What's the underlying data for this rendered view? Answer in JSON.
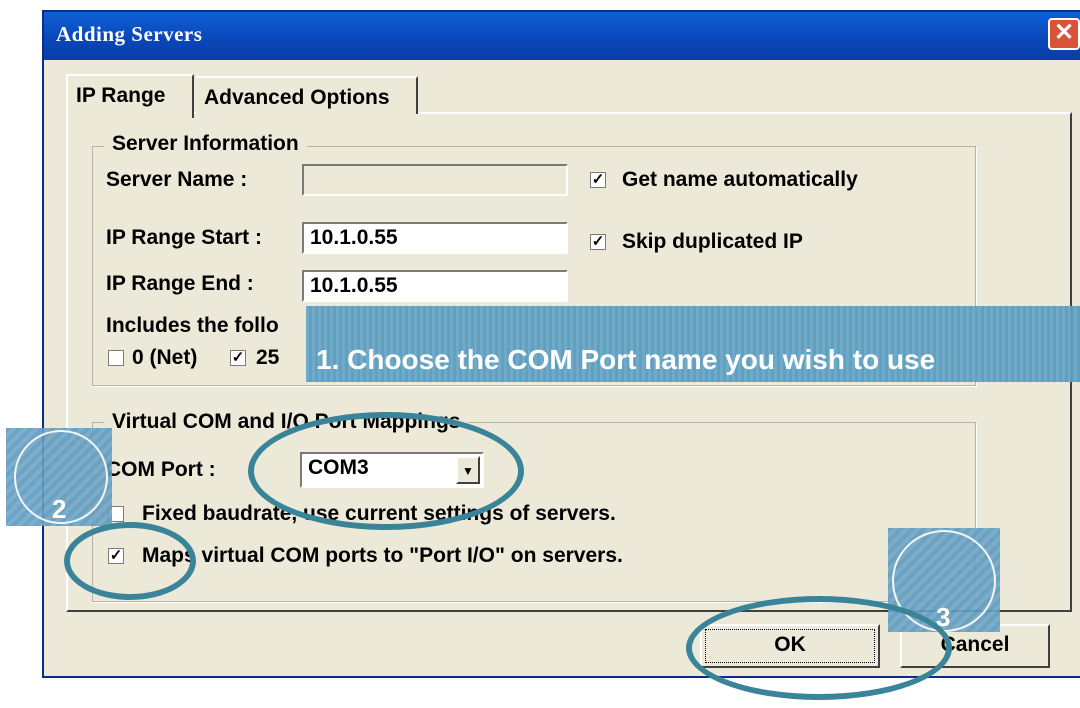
{
  "window": {
    "title": "Adding Servers",
    "close_glyph": "✕"
  },
  "tabs": [
    {
      "label": "IP Range",
      "selected": true
    },
    {
      "label": "Advanced Options",
      "selected": false
    }
  ],
  "server_info": {
    "group_label": "Server Information",
    "server_name_label": "Server Name :",
    "server_name_value": "",
    "get_name_auto_label": "Get name automatically",
    "get_name_auto_checked": true,
    "ip_start_label": "IP Range Start :",
    "ip_start_value": "10.1.0.55",
    "skip_dup_label": "Skip duplicated IP",
    "skip_dup_checked": true,
    "ip_end_label": "IP Range End :",
    "ip_end_value": "10.1.0.55",
    "includes_label": "Includes the follo",
    "opt_net_label": "0 (Net)",
    "opt_net_checked": false,
    "opt_bcast_label": "25",
    "opt_bcast_checked": true
  },
  "mappings": {
    "group_label": "Virtual COM and I/O Port Mappings",
    "com_port_label": "COM Port :",
    "com_port_value": "COM3",
    "fixed_baud_label": "Fixed baudrate, use current settings of servers.",
    "fixed_baud_checked": false,
    "maps_label": "Maps virtual COM ports to \"Port I/O\" on servers.",
    "maps_checked": true
  },
  "buttons": {
    "ok_label": "OK",
    "cancel_label": "Cancel"
  },
  "annotations": {
    "banner_text": "1. Choose the COM Port name you wish to use",
    "step2": "2",
    "step3": "3",
    "accent_color": "#3a8499"
  },
  "glyphs": {
    "check": "✓",
    "dropdown": "▼"
  }
}
